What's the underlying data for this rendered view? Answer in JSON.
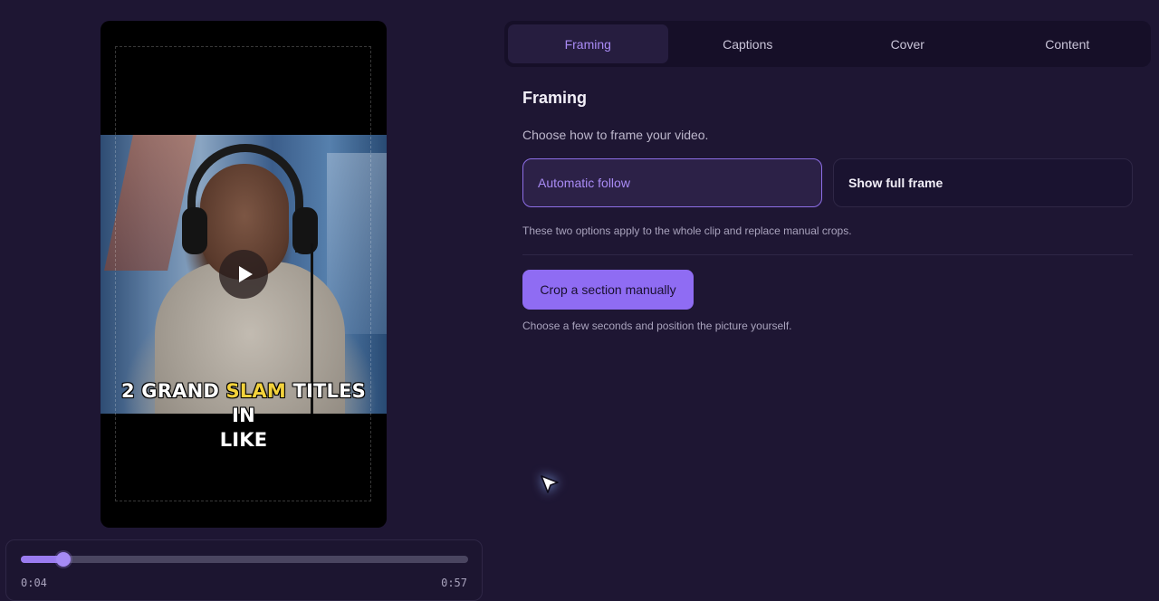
{
  "preview": {
    "caption_line1_a": "2 GRAND ",
    "caption_line1_hl": "SLAM",
    "caption_line1_b": " TITLES",
    "caption_line2": "IN",
    "caption_line3": "LIKE",
    "highlight_color": "#f3d23b"
  },
  "timeline": {
    "current": "0:04",
    "duration": "0:57",
    "progress": 0.095
  },
  "tabs": [
    {
      "label": "Framing",
      "active": true
    },
    {
      "label": "Captions",
      "active": false
    },
    {
      "label": "Cover",
      "active": false
    },
    {
      "label": "Content",
      "active": false
    }
  ],
  "framing": {
    "title": "Framing",
    "description": "Choose how to frame your video.",
    "option_auto": "Automatic follow",
    "option_full": "Show full frame",
    "options_note": "These two options apply to the whole clip and replace manual crops.",
    "crop_button": "Crop a section manually",
    "crop_note": "Choose a few seconds and position the picture yourself."
  },
  "colors": {
    "background": "#1e1633",
    "accent": "#8f6cf3",
    "accent_text": "#a98bf5"
  }
}
